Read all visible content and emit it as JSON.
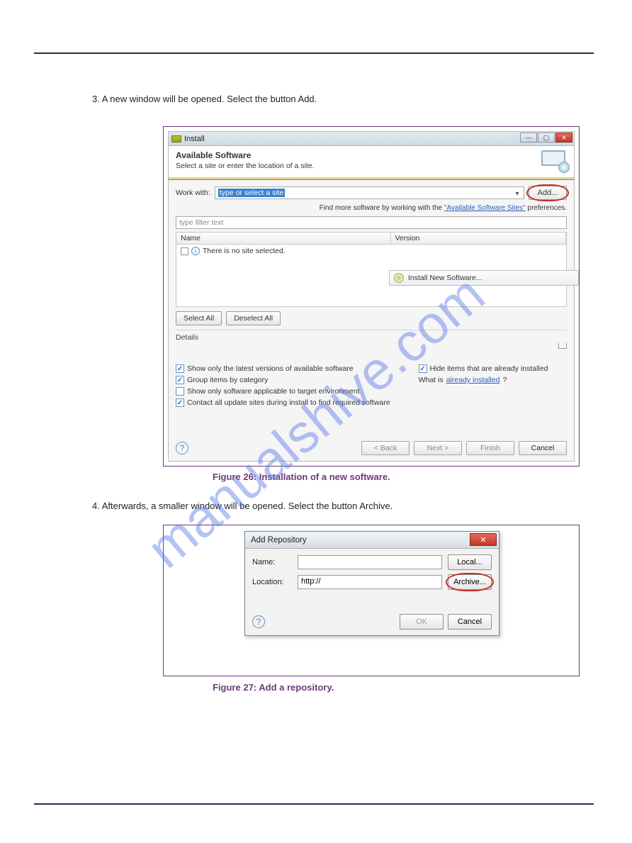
{
  "page": {
    "header_left": "",
    "header_right": "",
    "footer_left": "",
    "footer_right": ""
  },
  "intro1": "3. A new window will be opened. Select the button Add.",
  "intro2": "4. Afterwards, a smaller window will be opened. Select the button Archive.",
  "caption1": "Figure 26: Installation of a new software.",
  "caption2": "Figure 27: Add a repository.",
  "watermark": "manualshive.com",
  "install": {
    "window_title": "Install",
    "banner_title": "Available Software",
    "banner_sub": "Select a site or enter the location of a site.",
    "work_with_label": "Work with:",
    "work_with_value": "type or select a site",
    "add_label": "Add...",
    "findmore_prefix": "Find more software by working with the ",
    "findmore_link": "\"Available Software Sites\"",
    "findmore_suffix": " preferences.",
    "filter_text": "type filter text",
    "col_name": "Name",
    "col_version": "Version",
    "no_site": "There is no site selected.",
    "tooltip": "Install New Software...",
    "select_all": "Select All",
    "deselect_all": "Deselect All",
    "details_label": "Details",
    "opts": {
      "latest": "Show only the latest versions of available software",
      "group": "Group items by category",
      "target": "Show only software applicable to target environment",
      "contact": "Contact all update sites during install to find required software",
      "hide": "Hide items that are already installed",
      "whatis_prefix": "What is ",
      "whatis_link": "already installed",
      "whatis_suffix": "?"
    },
    "wiz": {
      "back": "< Back",
      "next": "Next >",
      "finish": "Finish",
      "cancel": "Cancel"
    }
  },
  "addrepo": {
    "title": "Add Repository",
    "name_label": "Name:",
    "name_value": "",
    "location_label": "Location:",
    "location_value": "http://",
    "local": "Local...",
    "archive": "Archive...",
    "ok": "OK",
    "cancel": "Cancel"
  }
}
